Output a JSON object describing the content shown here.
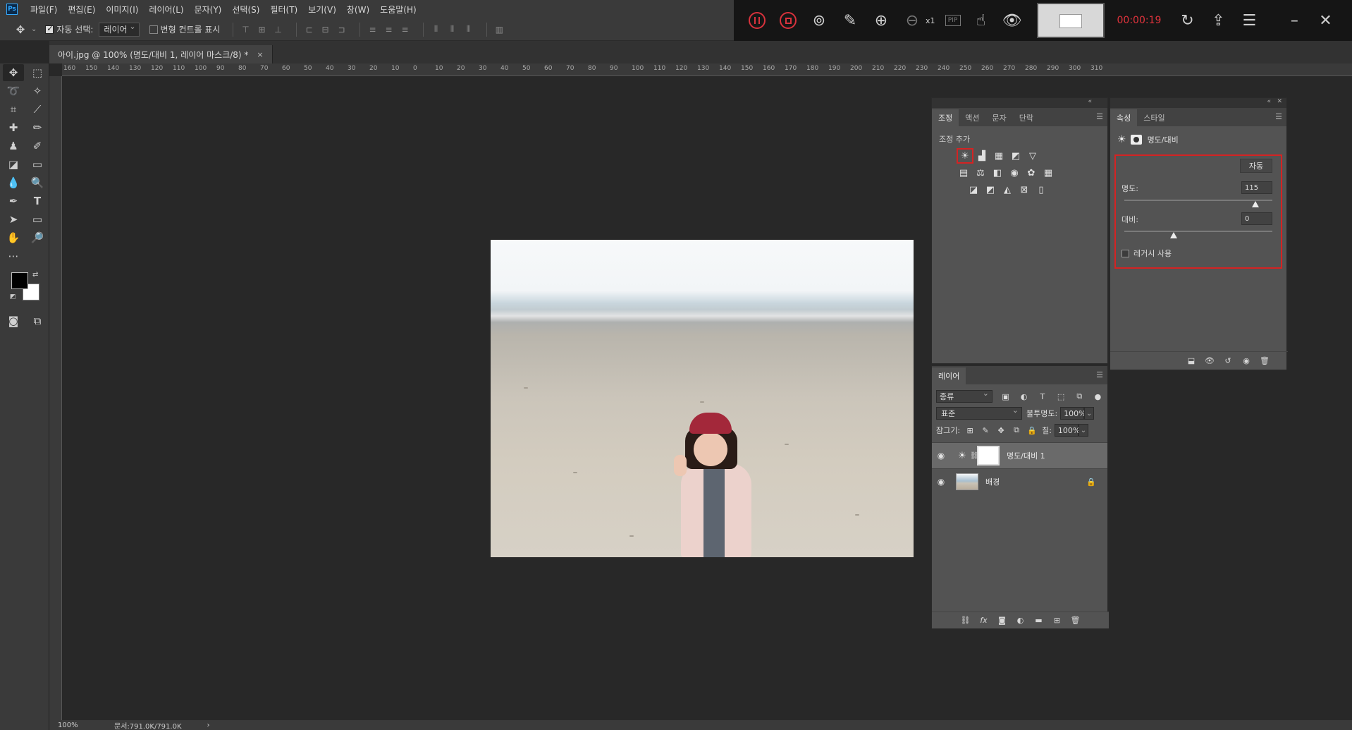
{
  "app": {
    "logo": "Ps"
  },
  "menu": [
    "파일(F)",
    "편집(E)",
    "이미지(I)",
    "레이어(L)",
    "문자(Y)",
    "선택(S)",
    "필터(T)",
    "보기(V)",
    "창(W)",
    "도움말(H)"
  ],
  "options_bar": {
    "auto_select_label": "자동 선택:",
    "auto_select_checked": true,
    "auto_select_target": "레이어",
    "transform_controls_label": "변형 컨트롤 표시",
    "transform_controls_checked": false
  },
  "recorder": {
    "elapsed": "00:00:19",
    "zoom_label": "x1",
    "pip_label": "PIP",
    "accent_color": "#e0333c"
  },
  "document": {
    "tab_title": "아이.jpg @ 100% (명도/대비 1, 레이어 마스크/8) *",
    "close_glyph": "×",
    "zoom_status": "100%",
    "doc_size_status": "문서:791.0K/791.0K",
    "status_arrow": "›"
  },
  "ruler": {
    "top_ticks": [
      "160",
      "150",
      "140",
      "130",
      "120",
      "110",
      "100",
      "90",
      "80",
      "70",
      "60",
      "50",
      "40",
      "30",
      "20",
      "10",
      "0",
      "10",
      "20",
      "30",
      "40",
      "50",
      "60",
      "70",
      "80",
      "90",
      "100",
      "110",
      "120",
      "130",
      "140",
      "150",
      "160",
      "170",
      "180",
      "190",
      "200",
      "210",
      "220",
      "230",
      "240",
      "250",
      "260",
      "270",
      "280",
      "290",
      "300",
      "310"
    ]
  },
  "adjustments_panel": {
    "tabs": [
      "조정",
      "액션",
      "문자",
      "단락"
    ],
    "active_tab": 0,
    "title": "조정 추가",
    "icons_row1": [
      "brightness-contrast-icon",
      "levels-icon",
      "curves-icon",
      "exposure-icon",
      "vibrance-icon"
    ],
    "icons_row2": [
      "hue-saturation-icon",
      "color-balance-icon",
      "black-white-icon",
      "photo-filter-icon",
      "channel-mixer-icon",
      "color-lookup-icon"
    ],
    "icons_row3": [
      "invert-icon",
      "posterize-icon",
      "threshold-icon",
      "selective-color-icon",
      "gradient-map-icon"
    ]
  },
  "layers_panel": {
    "tab": "레이어",
    "filter_kind": "종류",
    "blend_mode": "표준",
    "opacity_label": "불투명도:",
    "opacity_value": "100%",
    "lock_label": "잠그기:",
    "fill_label": "칠:",
    "fill_value": "100%",
    "layers": [
      {
        "name": "명도/대비 1",
        "type": "adjustment",
        "visible": true,
        "selected": true
      },
      {
        "name": "배경",
        "type": "image",
        "visible": true,
        "locked": true
      }
    ]
  },
  "properties_panel": {
    "tabs": [
      "속성",
      "스타일"
    ],
    "active_tab": 0,
    "title": "명도/대비",
    "auto_label": "자동",
    "brightness_label": "명도:",
    "brightness_value": "115",
    "contrast_label": "대비:",
    "contrast_value": "0",
    "legacy_label": "레거시 사용",
    "legacy_checked": false,
    "highlight_color": "#d42323"
  }
}
